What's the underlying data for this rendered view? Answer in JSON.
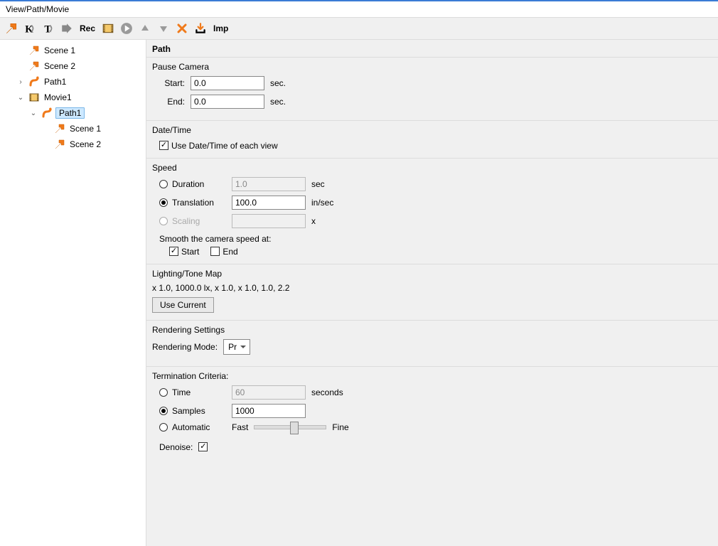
{
  "window": {
    "title": "View/Path/Movie"
  },
  "toolbar": {
    "rec_label": "Rec",
    "imp_label": "Imp"
  },
  "tree": {
    "items": [
      {
        "label": "Scene 1",
        "icon": "arrow",
        "indent": 1,
        "expander": ""
      },
      {
        "label": "Scene 2",
        "icon": "arrow",
        "indent": 1,
        "expander": ""
      },
      {
        "label": "Path1",
        "icon": "path",
        "indent": 1,
        "expander": "›"
      },
      {
        "label": "Movie1",
        "icon": "movie",
        "indent": 1,
        "expander": "⌄"
      },
      {
        "label": "Path1",
        "icon": "path",
        "indent": 2,
        "expander": "⌄",
        "selected": true
      },
      {
        "label": "Scene 1",
        "icon": "arrow",
        "indent": 3,
        "expander": ""
      },
      {
        "label": "Scene 2",
        "icon": "arrow",
        "indent": 3,
        "expander": ""
      }
    ]
  },
  "panel": {
    "title": "Path",
    "pause_camera": {
      "title": "Pause Camera",
      "start_label": "Start:",
      "start_value": "0.0",
      "end_label": "End:",
      "end_value": "0.0",
      "unit": "sec."
    },
    "datetime": {
      "title": "Date/Time",
      "use_each_view_label": "Use Date/Time of each view",
      "use_each_view_checked": true
    },
    "speed": {
      "title": "Speed",
      "duration_label": "Duration",
      "duration_value": "1.0",
      "duration_unit": "sec",
      "duration_selected": false,
      "translation_label": "Translation",
      "translation_value": "100.0",
      "translation_unit": "in/sec",
      "translation_selected": true,
      "scaling_label": "Scaling",
      "scaling_value": "",
      "scaling_unit": "x",
      "scaling_selected": false,
      "scaling_enabled": false,
      "smooth_title": "Smooth the camera speed at:",
      "smooth_start_label": "Start",
      "smooth_start_checked": true,
      "smooth_end_label": "End",
      "smooth_end_checked": false
    },
    "lighting": {
      "title": "Lighting/Tone Map",
      "summary": "x 1.0, 1000.0 lx, x 1.0, x 1.0, 1.0, 2.2",
      "use_current_label": "Use Current"
    },
    "rendering": {
      "title": "Rendering Settings",
      "mode_label": "Rendering Mode:",
      "mode_value": "Pr"
    },
    "termination": {
      "title": "Termination Criteria:",
      "time_label": "Time",
      "time_value": "60",
      "time_unit": "seconds",
      "time_selected": false,
      "samples_label": "Samples",
      "samples_value": "1000",
      "samples_selected": true,
      "auto_label": "Automatic",
      "auto_selected": false,
      "fast_label": "Fast",
      "fine_label": "Fine",
      "denoise_label": "Denoise:",
      "denoise_checked": true
    }
  }
}
